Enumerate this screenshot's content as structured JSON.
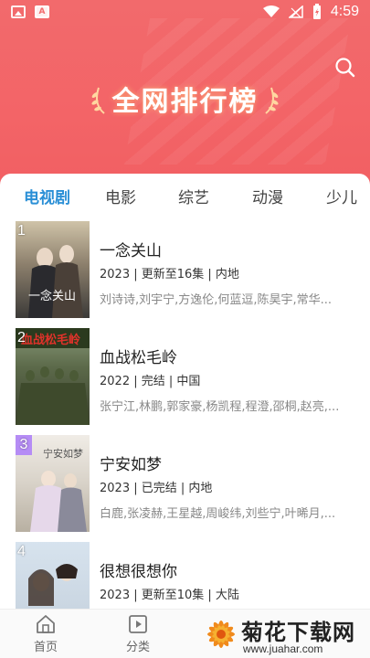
{
  "status_bar": {
    "time": "4:59"
  },
  "header": {
    "title": "全网排行榜",
    "search_icon": "search-icon"
  },
  "tabs": [
    {
      "label": "电视剧",
      "active": true
    },
    {
      "label": "电影",
      "active": false
    },
    {
      "label": "综艺",
      "active": false
    },
    {
      "label": "动漫",
      "active": false
    },
    {
      "label": "少儿",
      "active": false
    }
  ],
  "items": [
    {
      "rank": "1",
      "title": "一念关山",
      "meta": "2023 | 更新至16集 | 内地",
      "cast": "刘诗诗,刘宇宁,方逸伦,何蓝逗,陈昊宇,常华..."
    },
    {
      "rank": "2",
      "title": "血战松毛岭",
      "meta": "2022 | 完结 | 中国",
      "cast": "张宁江,林鹏,郭家豪,杨凯程,程澄,邵桐,赵亮,..."
    },
    {
      "rank": "3",
      "title": "宁安如梦",
      "meta": "2023 | 已完结 | 内地",
      "cast": "白鹿,张凌赫,王星越,周峻纬,刘些宁,叶晞月,..."
    },
    {
      "rank": "4",
      "title": "很想很想你",
      "meta": "2023 | 更新至10集 | 大陆",
      "cast": ""
    }
  ],
  "bottom_nav": [
    {
      "label": "首页",
      "icon": "home-icon"
    },
    {
      "label": "分类",
      "icon": "category-icon"
    }
  ],
  "watermark": {
    "main": "菊花下载网",
    "sub": "www.juahar.com"
  },
  "colors": {
    "accent": "#2a8fd6",
    "header": "#f26a6c"
  }
}
